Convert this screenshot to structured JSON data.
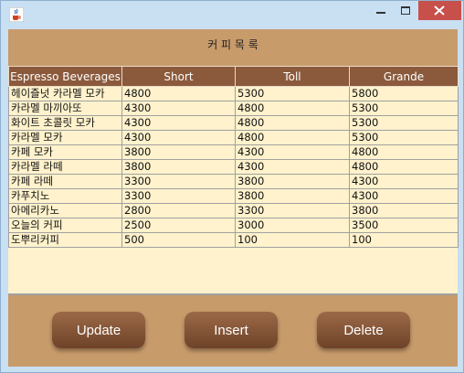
{
  "window": {
    "icon": "java-coffee-cup-icon",
    "controls": [
      "minimize-icon",
      "maximize-icon",
      "close-icon"
    ]
  },
  "heading": "커 피 목 록",
  "table": {
    "columns": [
      "Espresso Beverages",
      "Short",
      "Toll",
      "Grande"
    ],
    "rows": [
      [
        "헤이즐넛 카라멜 모카",
        "4800",
        "5300",
        "5800"
      ],
      [
        "카라멜  마끼아또",
        "4300",
        "4800",
        "5300"
      ],
      [
        "화이트 초콜릿 모카",
        "4300",
        "4800",
        "5300"
      ],
      [
        "카라멜 모카",
        "4300",
        "4800",
        "5300"
      ],
      [
        "카페 모카",
        "3800",
        "4300",
        "4800"
      ],
      [
        "카라멜 라떼",
        "3800",
        "4300",
        "4800"
      ],
      [
        "카페 라떼",
        "3300",
        "3800",
        "4300"
      ],
      [
        "카푸치노",
        "3300",
        "3800",
        "4300"
      ],
      [
        "아메리카노",
        "2800",
        "3300",
        "3800"
      ],
      [
        "오늘의 커피",
        "2500",
        "3000",
        "3500"
      ],
      [
        "도뿌리커피",
        "500",
        "100",
        "100"
      ]
    ]
  },
  "buttons": {
    "update": "Update",
    "insert": "Insert",
    "delete": "Delete"
  },
  "colors": {
    "background": "#c89b6b",
    "header": "#8b5a3c",
    "table_bg": "#fff2cc",
    "close": "#c7504a"
  }
}
